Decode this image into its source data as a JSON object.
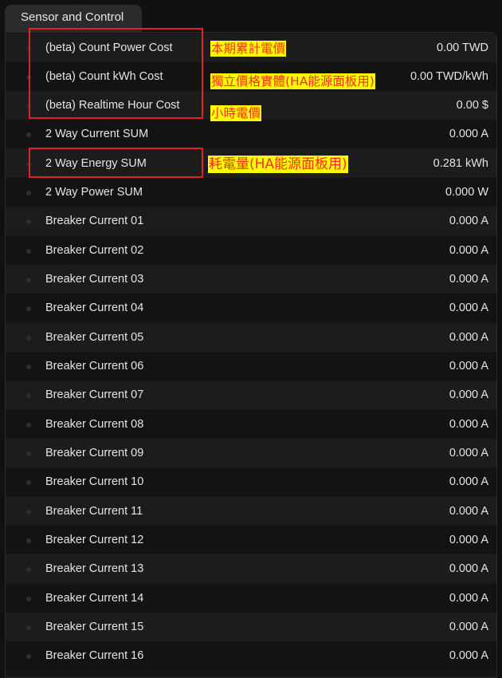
{
  "tab": {
    "label": "Sensor and Control"
  },
  "rows": [
    {
      "label": "(beta) Count Power Cost",
      "value": "0.00 TWD"
    },
    {
      "label": "(beta) Count kWh Cost",
      "value": "0.00 TWD/kWh"
    },
    {
      "label": "(beta) Realtime Hour Cost",
      "value": "0.00 $"
    },
    {
      "label": "2 Way Current SUM",
      "value": "0.000 A"
    },
    {
      "label": "2 Way Energy SUM",
      "value": "0.281 kWh"
    },
    {
      "label": "2 Way Power SUM",
      "value": "0.000 W"
    },
    {
      "label": "Breaker Current 01",
      "value": "0.000 A"
    },
    {
      "label": "Breaker Current 02",
      "value": "0.000 A"
    },
    {
      "label": "Breaker Current 03",
      "value": "0.000 A"
    },
    {
      "label": "Breaker Current 04",
      "value": "0.000 A"
    },
    {
      "label": "Breaker Current 05",
      "value": "0.000 A"
    },
    {
      "label": "Breaker Current 06",
      "value": "0.000 A"
    },
    {
      "label": "Breaker Current 07",
      "value": "0.000 A"
    },
    {
      "label": "Breaker Current 08",
      "value": "0.000 A"
    },
    {
      "label": "Breaker Current 09",
      "value": "0.000 A"
    },
    {
      "label": "Breaker Current 10",
      "value": "0.000 A"
    },
    {
      "label": "Breaker Current 11",
      "value": "0.000 A"
    },
    {
      "label": "Breaker Current 12",
      "value": "0.000 A"
    },
    {
      "label": "Breaker Current 13",
      "value": "0.000 A"
    },
    {
      "label": "Breaker Current 14",
      "value": "0.000 A"
    },
    {
      "label": "Breaker Current 15",
      "value": "0.000 A"
    },
    {
      "label": "Breaker Current 16",
      "value": "0.000 A"
    }
  ],
  "annotations": {
    "power_cost": "本期累計電價",
    "kwh_cost": "獨立價格實體(HA能源面板用)",
    "hour_cost": "小時電價",
    "energy_sum": "耗電量(HA能源面板用)"
  },
  "colors": {
    "background": "#111111",
    "highlight_box": "#e0202a",
    "note_background": "#ffff00",
    "note_text": "#ff2a1a"
  }
}
